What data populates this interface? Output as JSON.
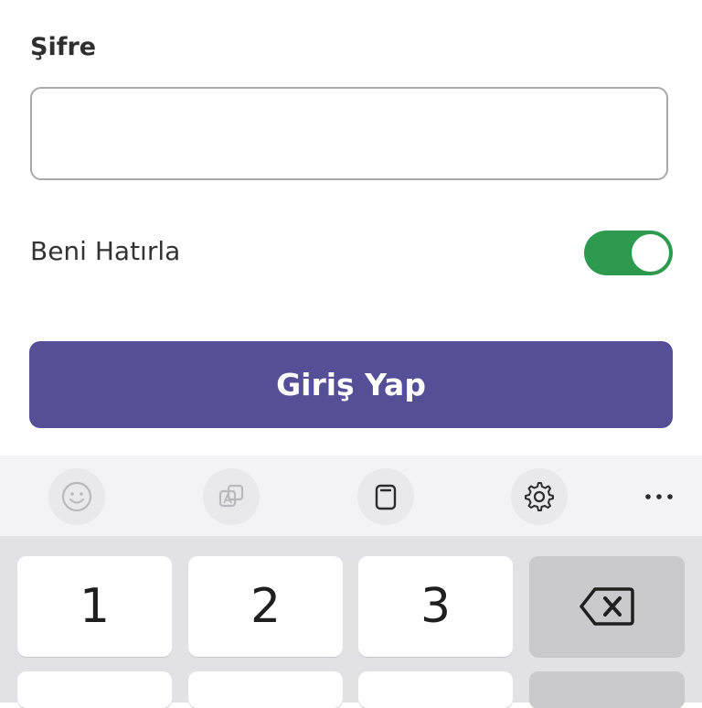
{
  "form": {
    "password_label": "Şifre",
    "password_value": "",
    "remember_label": "Beni Hatırla",
    "remember_on": true,
    "login_label": "Giriş Yap"
  },
  "keyboard": {
    "toolbar": [
      "emoji-icon",
      "translate-icon",
      "clipboard-icon",
      "gear-icon",
      "more-icon"
    ],
    "keys_row1": [
      "1",
      "2",
      "3"
    ]
  },
  "colors": {
    "toggle_on": "#2e9a4f",
    "button": "#544f96"
  }
}
